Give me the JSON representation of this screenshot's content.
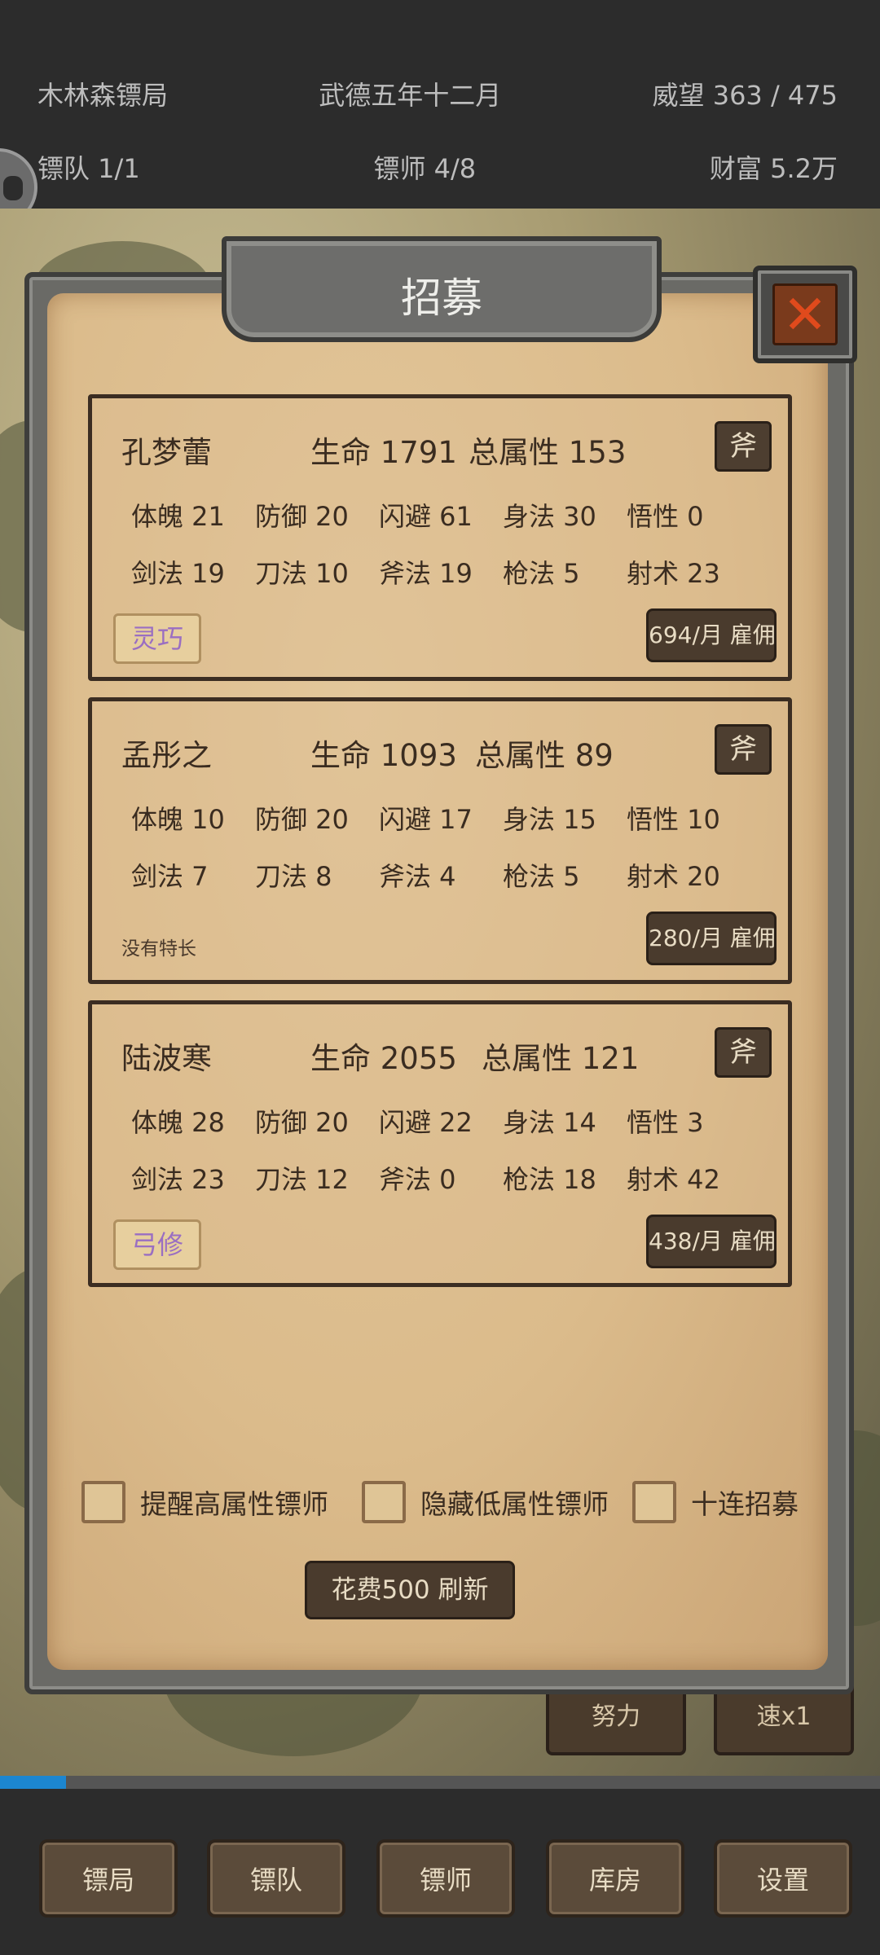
{
  "header": {
    "company": "木林森镖局",
    "date": "武德五年十二月",
    "prestige": "威望 363 / 475",
    "teams": "镖队 1/1",
    "escorts": "镖师 4/8",
    "wealth": "财富  5.2万"
  },
  "background_buttons": {
    "left": "努力",
    "right": "速x1"
  },
  "progress": {
    "fraction": 0.075,
    "color": "#1c86d0"
  },
  "dialog": {
    "title": "招募",
    "close_icon": "close-x-icon",
    "candidates": [
      {
        "name": "孔梦蕾",
        "life": "生命 1791",
        "total": "总属性 153",
        "weapon": "斧",
        "stats_row1": [
          "体魄 21",
          "防御 20",
          "闪避 61",
          "身法 30",
          "悟性 0"
        ],
        "stats_row2": [
          "剑法 19",
          "刀法 10",
          "斧法 19",
          "枪法 5",
          "射术 23"
        ],
        "trait": "灵巧",
        "hire": "694/月 雇佣"
      },
      {
        "name": "孟彤之",
        "life": "生命 1093",
        "total": "总属性 89",
        "weapon": "斧",
        "stats_row1": [
          "体魄 10",
          "防御 20",
          "闪避 17",
          "身法 15",
          "悟性 10"
        ],
        "stats_row2": [
          "剑法 7",
          "刀法 8",
          "斧法 4",
          "枪法 5",
          "射术 20"
        ],
        "trait_none": "没有特长",
        "hire": "280/月 雇佣"
      },
      {
        "name": "陆波寒",
        "life": "生命 2055",
        "total": "总属性 121",
        "weapon": "斧",
        "stats_row1": [
          "体魄 28",
          "防御 20",
          "闪避 22",
          "身法 14",
          "悟性 3"
        ],
        "stats_row2": [
          "剑法 23",
          "刀法 12",
          "斧法 0",
          "枪法 18",
          "射术 42"
        ],
        "trait": "弓修",
        "hire": "438/月 雇佣"
      }
    ],
    "options": {
      "remind_high": "提醒高属性镖师",
      "hide_low": "隐藏低属性镖师",
      "ten_draw": "十连招募"
    },
    "refresh": "花费500 刷新"
  },
  "nav": {
    "items": [
      "镖局",
      "镖队",
      "镖师",
      "库房",
      "设置"
    ]
  }
}
